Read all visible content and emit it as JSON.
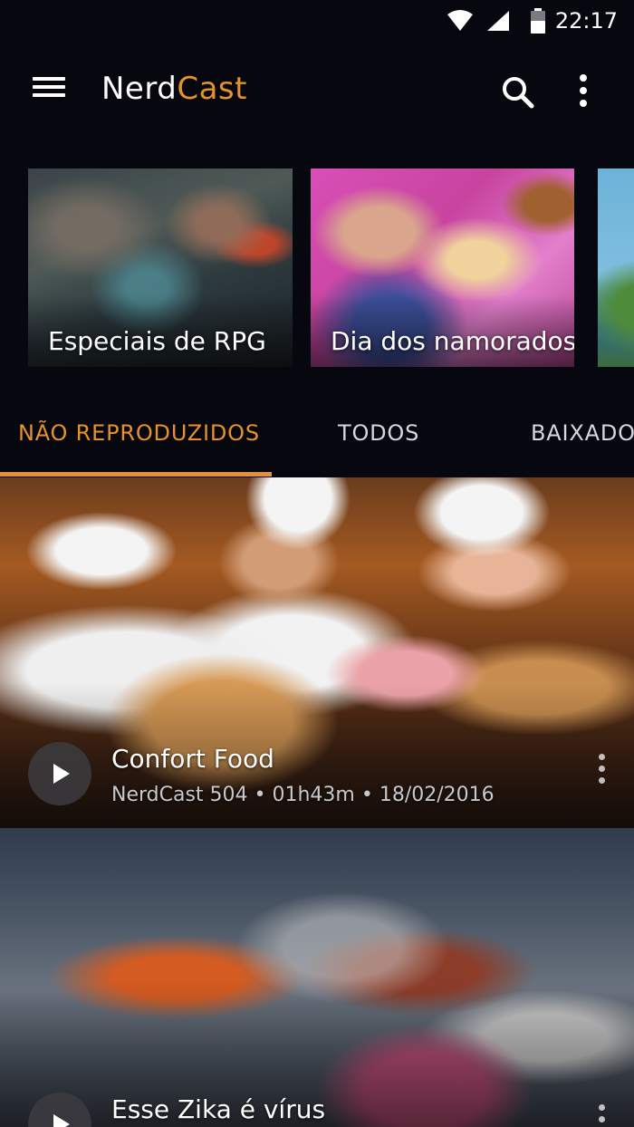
{
  "status_bar": {
    "time": "22:17",
    "icons": [
      "wifi-icon",
      "cell-signal-icon",
      "battery-icon"
    ]
  },
  "app_bar": {
    "title_part1": "Nerd",
    "title_part2": "Cast",
    "title_color1": "#ffffff",
    "title_color2": "#e4912e",
    "icons": [
      "menu-icon",
      "search-icon",
      "more-vertical-icon"
    ]
  },
  "categories": [
    {
      "label": "Especiais de RPG"
    },
    {
      "label": "Dia dos namorados"
    },
    {
      "label": ""
    }
  ],
  "tabs": [
    {
      "label": "NÃO REPRODUZIDOS",
      "active": true
    },
    {
      "label": "TODOS",
      "active": false
    },
    {
      "label": "BAIXADOS",
      "active": false
    }
  ],
  "episodes": [
    {
      "title": "Confort Food",
      "meta": "NerdCast 504 • 01h43m • 18/02/2016"
    },
    {
      "title": "Esse Zika é vírus",
      "meta": ""
    }
  ],
  "colors": {
    "accent": "#e4912e",
    "background": "#07070f",
    "tab_inactive": "#d6d6dc"
  }
}
